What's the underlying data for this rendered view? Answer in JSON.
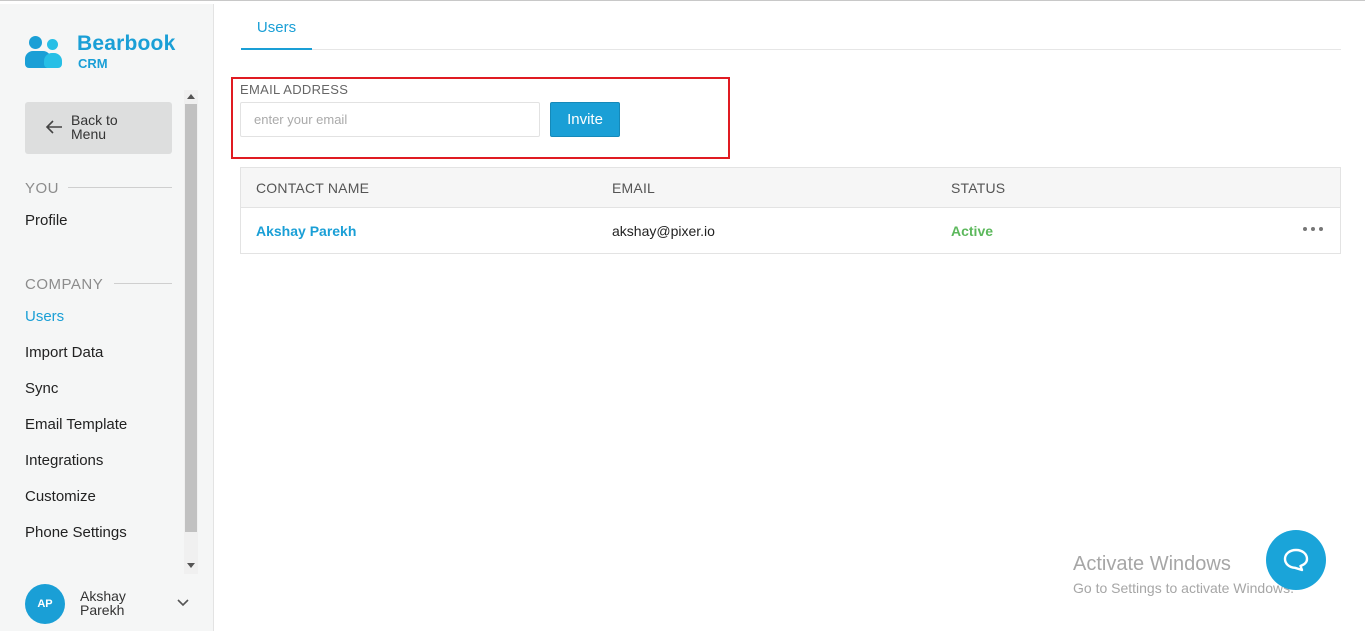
{
  "app": {
    "brand_name": "Bearbook",
    "brand_sub": "CRM"
  },
  "sidebar": {
    "back_label": "Back to Menu",
    "section_you": "YOU",
    "profile_label": "Profile",
    "section_company": "COMPANY",
    "items": [
      {
        "label": "Users",
        "active": true
      },
      {
        "label": "Import Data"
      },
      {
        "label": "Sync"
      },
      {
        "label": "Email Template"
      },
      {
        "label": "Integrations"
      },
      {
        "label": "Customize"
      },
      {
        "label": "Phone Settings"
      }
    ],
    "user": {
      "initials": "AP",
      "name": "Akshay Parekh"
    }
  },
  "main": {
    "tab": "Users",
    "invite": {
      "label": "EMAIL ADDRESS",
      "placeholder": "enter your email",
      "button": "Invite"
    },
    "table": {
      "headers": [
        "CONTACT NAME",
        "EMAIL",
        "STATUS"
      ],
      "rows": [
        {
          "name": "Akshay Parekh",
          "email": "akshay@pixer.io",
          "status": "Active"
        }
      ]
    }
  },
  "overlay": {
    "watermark_title": "Activate Windows",
    "watermark_sub": "Go to Settings to activate Windows."
  },
  "colors": {
    "accent": "#1a9fd6",
    "status_active": "#5cb85c",
    "highlight_border": "#e01b22"
  }
}
